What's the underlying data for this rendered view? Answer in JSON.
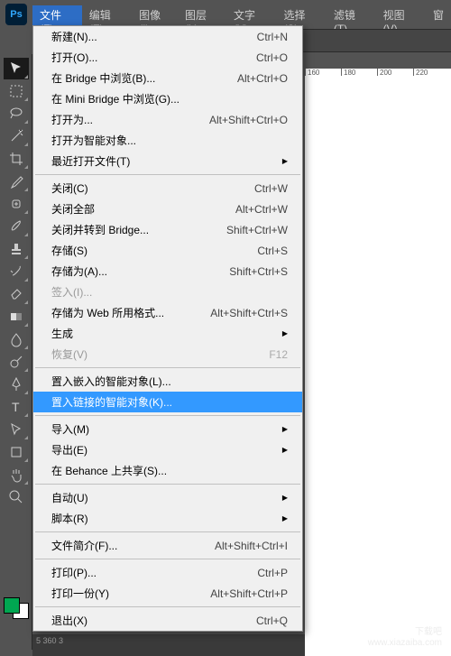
{
  "app_icon": "Ps",
  "menubar": [
    {
      "label": "文件(F)",
      "active": true
    },
    {
      "label": "编辑(E)"
    },
    {
      "label": "图像(I)"
    },
    {
      "label": "图层(L)"
    },
    {
      "label": "文字(Y)"
    },
    {
      "label": "选择(S)"
    },
    {
      "label": "滤镜(T)"
    },
    {
      "label": "视图(V)"
    },
    {
      "label": "窗"
    }
  ],
  "dropdown": [
    {
      "label": "新建(N)...",
      "shortcut": "Ctrl+N"
    },
    {
      "label": "打开(O)...",
      "shortcut": "Ctrl+O"
    },
    {
      "label": "在 Bridge 中浏览(B)...",
      "shortcut": "Alt+Ctrl+O"
    },
    {
      "label": "在 Mini Bridge 中浏览(G)..."
    },
    {
      "label": "打开为...",
      "shortcut": "Alt+Shift+Ctrl+O"
    },
    {
      "label": "打开为智能对象..."
    },
    {
      "label": "最近打开文件(T)",
      "submenu": true
    },
    {
      "sep": true
    },
    {
      "label": "关闭(C)",
      "shortcut": "Ctrl+W"
    },
    {
      "label": "关闭全部",
      "shortcut": "Alt+Ctrl+W"
    },
    {
      "label": "关闭并转到 Bridge...",
      "shortcut": "Shift+Ctrl+W"
    },
    {
      "label": "存储(S)",
      "shortcut": "Ctrl+S"
    },
    {
      "label": "存储为(A)...",
      "shortcut": "Shift+Ctrl+S"
    },
    {
      "label": "签入(I)...",
      "disabled": true
    },
    {
      "label": "存储为 Web 所用格式...",
      "shortcut": "Alt+Shift+Ctrl+S"
    },
    {
      "label": "生成",
      "submenu": true
    },
    {
      "label": "恢复(V)",
      "shortcut": "F12",
      "disabled": true
    },
    {
      "sep": true
    },
    {
      "label": "置入嵌入的智能对象(L)..."
    },
    {
      "label": "置入链接的智能对象(K)...",
      "highlighted": true
    },
    {
      "sep": true
    },
    {
      "label": "导入(M)",
      "submenu": true
    },
    {
      "label": "导出(E)",
      "submenu": true
    },
    {
      "label": "在 Behance 上共享(S)..."
    },
    {
      "sep": true
    },
    {
      "label": "自动(U)",
      "submenu": true
    },
    {
      "label": "脚本(R)",
      "submenu": true
    },
    {
      "sep": true
    },
    {
      "label": "文件简介(F)...",
      "shortcut": "Alt+Shift+Ctrl+I"
    },
    {
      "sep": true
    },
    {
      "label": "打印(P)...",
      "shortcut": "Ctrl+P"
    },
    {
      "label": "打印一份(Y)",
      "shortcut": "Alt+Shift+Ctrl+P"
    },
    {
      "sep": true
    },
    {
      "label": "退出(X)",
      "shortcut": "Ctrl+Q"
    }
  ],
  "ruler_marks": [
    "160",
    "180",
    "200",
    "220"
  ],
  "watermark_line1": "下载吧",
  "watermark_line2": "www.xiazaiba.com",
  "bottom_numbers": "5\n360\n3"
}
